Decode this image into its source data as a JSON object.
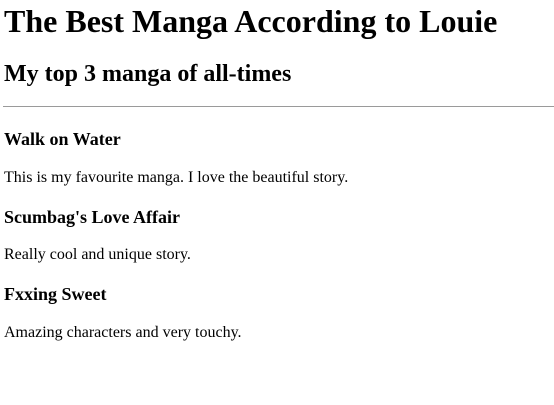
{
  "page": {
    "title": "The Best Manga According to Louie",
    "subtitle": "My top 3 manga of all-times"
  },
  "manga": [
    {
      "title": "Walk on Water",
      "description": "This is my favourite manga. I love the beautiful story."
    },
    {
      "title": "Scumbag's Love Affair",
      "description": "Really cool and unique story."
    },
    {
      "title": "Fxxing Sweet",
      "description": "Amazing characters and very touchy."
    }
  ]
}
